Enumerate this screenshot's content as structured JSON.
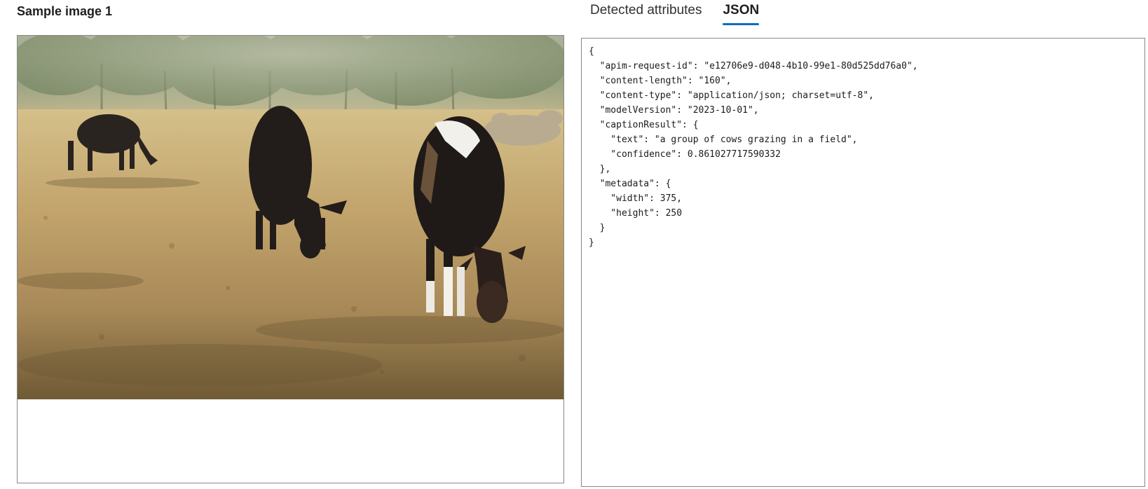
{
  "left_panel": {
    "title": "Sample image 1"
  },
  "tabs": [
    {
      "label": "Detected attributes",
      "active": false
    },
    {
      "label": "JSON",
      "active": true
    }
  ],
  "colors": {
    "accent": "#0f6cbd",
    "border": "#8a8886"
  },
  "json_view": {
    "text": "{\n  \"apim-request-id\": \"e12706e9-d048-4b10-99e1-80d525dd76a0\",\n  \"content-length\": \"160\",\n  \"content-type\": \"application/json; charset=utf-8\",\n  \"modelVersion\": \"2023-10-01\",\n  \"captionResult\": {\n    \"text\": \"a group of cows grazing in a field\",\n    \"confidence\": 0.861027717590332\n  },\n  \"metadata\": {\n    \"width\": 375,\n    \"height\": 250\n  }\n}"
  }
}
